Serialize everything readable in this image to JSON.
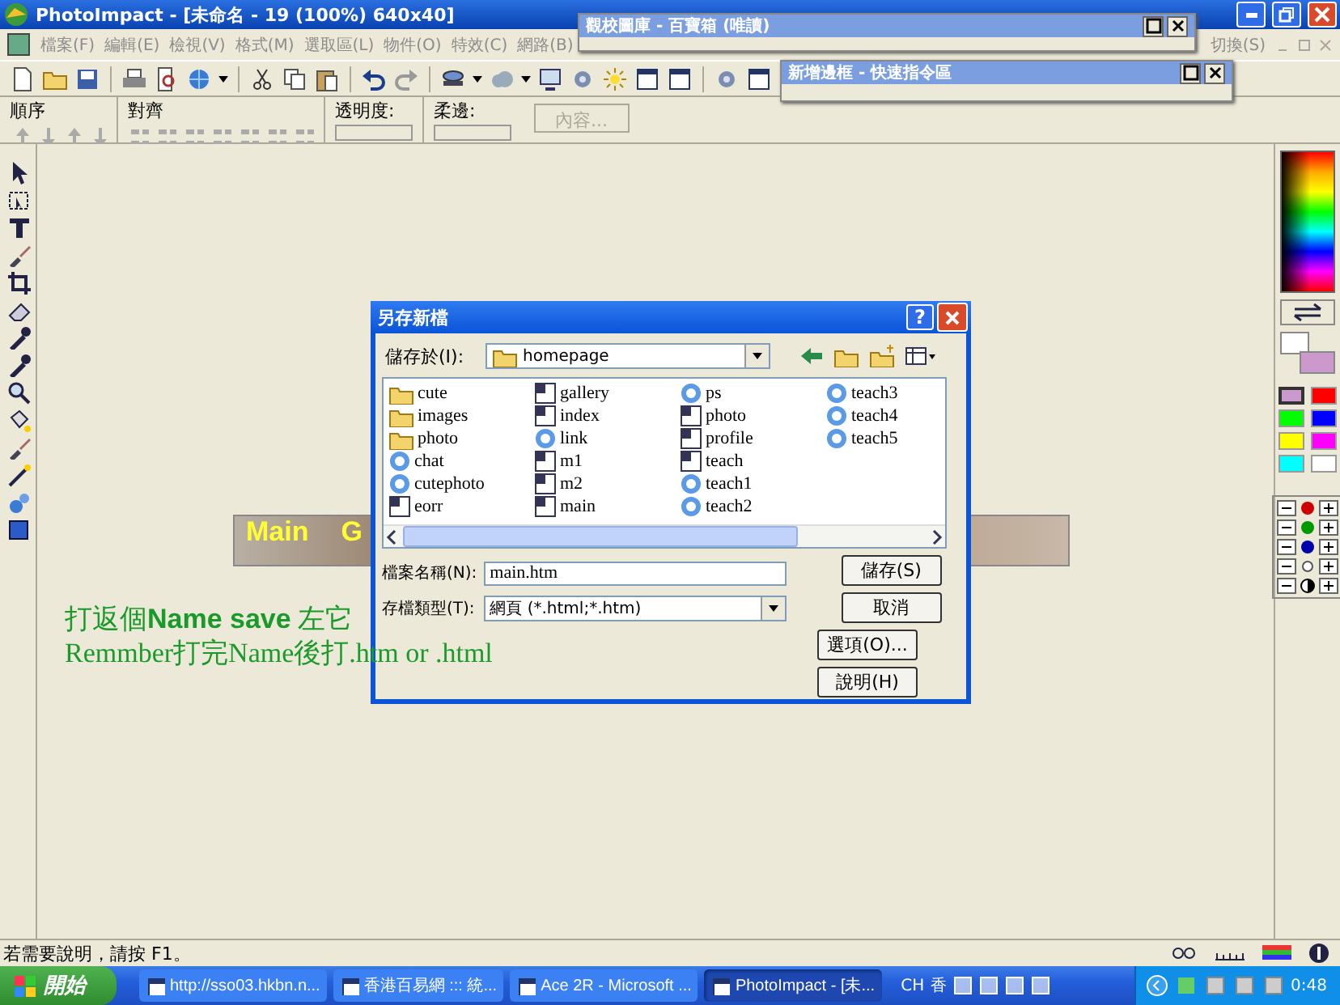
{
  "window": {
    "title": "PhotoImpact - [未命名 - 19 (100%) 640x40]"
  },
  "menu": [
    {
      "label": "檔案(F)",
      "disabled": true
    },
    {
      "label": "編輯(E)",
      "disabled": true
    },
    {
      "label": "檢視(V)",
      "disabled": true
    },
    {
      "label": "格式(M)",
      "disabled": true
    },
    {
      "label": "選取區(L)",
      "disabled": true
    },
    {
      "label": "物件(O)",
      "disabled": true
    },
    {
      "label": "特效(C)",
      "disabled": true
    },
    {
      "label": "網路(B)",
      "disabled": true
    }
  ],
  "menu_right": {
    "label": "切換(S)",
    "disabled": true
  },
  "attribute_bar": {
    "order_label": "順序",
    "align_label": "對齊",
    "opacity_label": "透明度:",
    "soft_edge_label": "柔邊:",
    "properties_button": {
      "label": "內容...",
      "disabled": true
    }
  },
  "panels": [
    {
      "title": "觀校圖庫 - 百寶箱 (唯讀)"
    },
    {
      "title": "新增邊框 - 快速指令區"
    }
  ],
  "canvas": {
    "banner_texts": [
      "Main",
      "G"
    ]
  },
  "annotation": {
    "lines": [
      "打返個**Name save** 左它",
      "Remmber打完Name後打.htm or .html"
    ]
  },
  "dialog": {
    "title": "另存新檔",
    "help_button": "?",
    "save_in_label": "儲存於(I):",
    "save_in_value": "homepage",
    "files": [
      {
        "name": "cute",
        "kind": "folder"
      },
      {
        "name": "images",
        "kind": "folder"
      },
      {
        "name": "photo",
        "kind": "folder"
      },
      {
        "name": "chat",
        "kind": "web"
      },
      {
        "name": "cutephoto",
        "kind": "web"
      },
      {
        "name": "eorr",
        "kind": "doc"
      },
      {
        "name": "gallery",
        "kind": "doc"
      },
      {
        "name": "index",
        "kind": "doc"
      },
      {
        "name": "link",
        "kind": "web"
      },
      {
        "name": "m1",
        "kind": "doc"
      },
      {
        "name": "m2",
        "kind": "doc"
      },
      {
        "name": "main",
        "kind": "doc"
      },
      {
        "name": "ps",
        "kind": "web"
      },
      {
        "name": "photo",
        "kind": "doc"
      },
      {
        "name": "profile",
        "kind": "doc"
      },
      {
        "name": "teach",
        "kind": "doc"
      },
      {
        "name": "teach1",
        "kind": "web"
      },
      {
        "name": "teach2",
        "kind": "web"
      },
      {
        "name": "teach3",
        "kind": "web"
      },
      {
        "name": "teach4",
        "kind": "web"
      },
      {
        "name": "teach5",
        "kind": "web"
      }
    ],
    "filename_label": "檔案名稱(N):",
    "filename_value": "main.htm",
    "type_label": "存檔類型(T):",
    "type_value": "網頁 (*.html;*.htm)",
    "buttons": [
      "儲存(S)",
      "取消",
      "選項(O)...",
      "說明(H)"
    ]
  },
  "palette": {
    "current_colors": [
      {
        "color": "#ffffff"
      },
      {
        "color": "#cc99cc"
      }
    ],
    "swatches": [
      {
        "color": "#cc99cc",
        "selected": true
      },
      {
        "color": "#ff0000",
        "selected": false
      },
      {
        "color": "#00ff00",
        "selected": false
      },
      {
        "color": "#0000ff",
        "selected": false
      },
      {
        "color": "#ffff00",
        "selected": false
      },
      {
        "color": "#ff00ff",
        "selected": false
      },
      {
        "color": "#00ffff",
        "selected": false
      },
      {
        "color": "#ffffff",
        "selected": false
      }
    ]
  },
  "status_bar": {
    "text": "若需要說明，請按 F1。"
  },
  "taskbar": {
    "start": "開始",
    "tasks": [
      {
        "label": "http://sso03.hkbn.n...",
        "selected": false
      },
      {
        "label": "香港百易網 ::: 統...",
        "selected": false
      },
      {
        "label": "Ace 2R - Microsoft ...",
        "selected": false
      },
      {
        "label": "PhotoImpact - [未...",
        "selected": true
      }
    ],
    "tray": {
      "ime": "CH",
      "ime_mode": "香",
      "clock": "0:48"
    }
  }
}
